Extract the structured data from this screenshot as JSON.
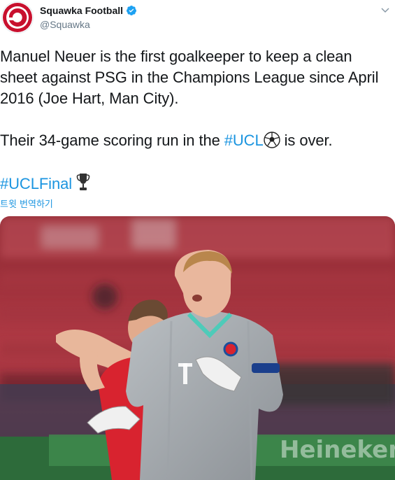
{
  "account": {
    "display_name": "Squawka Football",
    "handle": "@Squawka",
    "verified": true,
    "brand_color": "#c8102e"
  },
  "tweet": {
    "paragraph1": "Manuel Neuer is the first goalkeeper to keep a clean sheet against PSG in the Champions League since April 2016 (Joe Hart, Man City).",
    "paragraph2_before": "Their 34-game scoring run in the ",
    "hashtag_ucl": "#UCL",
    "paragraph2_after": " is over.",
    "hashtag_final": "#UCLFinal",
    "translate_label": "트윗 번역하기",
    "link_color": "#1b95e0"
  },
  "media": {
    "description_icon": "photo",
    "banner_text": "Heineken",
    "shirt_sponsor": "T"
  }
}
